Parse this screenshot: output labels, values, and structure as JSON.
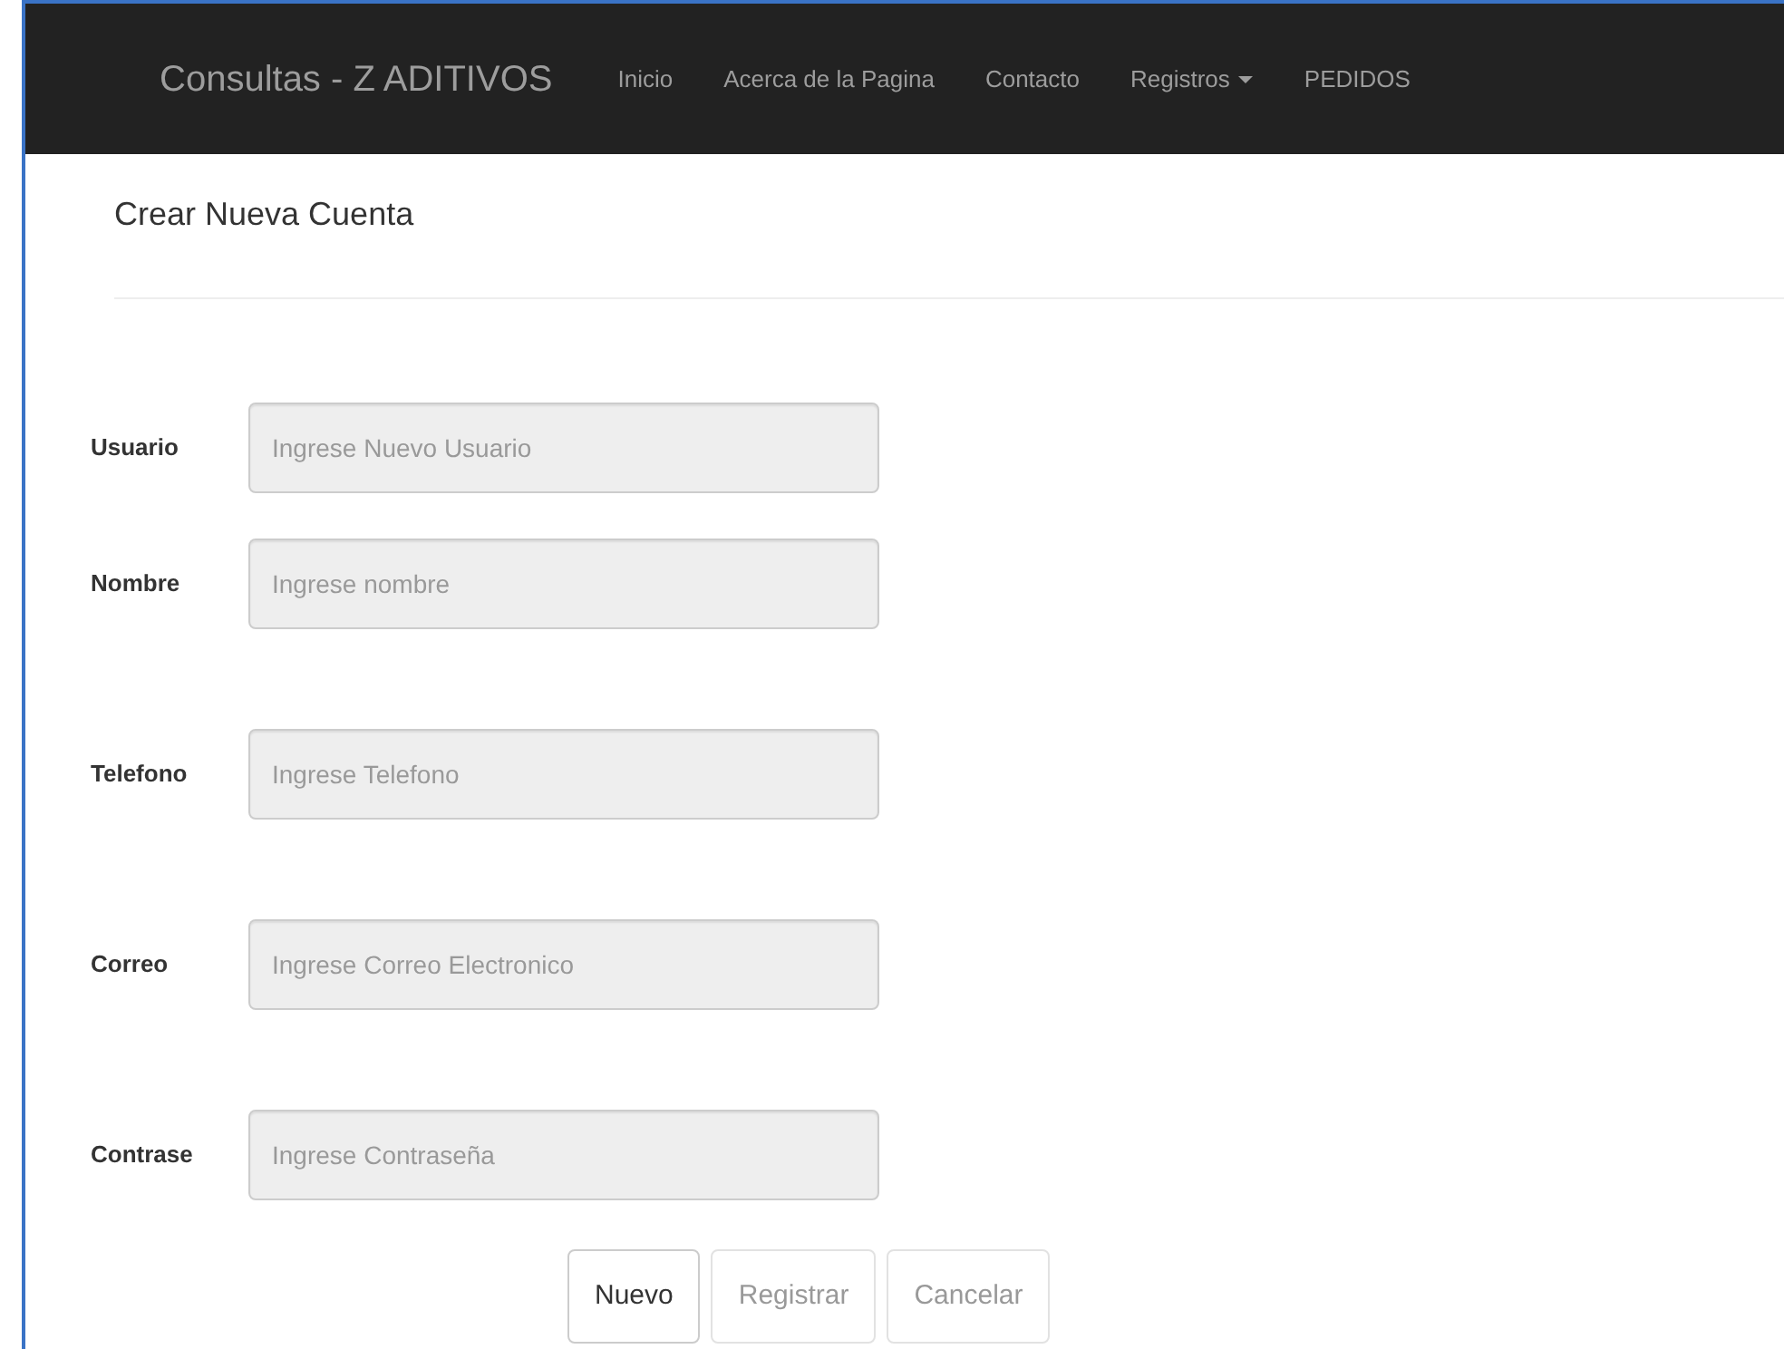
{
  "navbar": {
    "brand": "Consultas - Z ADITIVOS",
    "links": [
      {
        "label": "Inicio",
        "kind": "link"
      },
      {
        "label": "Acerca de la Pagina",
        "kind": "link"
      },
      {
        "label": "Contacto",
        "kind": "link"
      },
      {
        "label": "Registros",
        "kind": "dropdown"
      },
      {
        "label": "PEDIDOS",
        "kind": "link"
      }
    ]
  },
  "page_title": "Crear Nueva Cuenta",
  "form": {
    "fields": [
      {
        "label": "Usuario",
        "placeholder": "Ingrese Nuevo Usuario",
        "disabled": true
      },
      {
        "label": "Nombre",
        "placeholder": "Ingrese nombre",
        "disabled": true
      },
      {
        "label": "Telefono",
        "placeholder": "Ingrese Telefono",
        "disabled": true
      },
      {
        "label": "Correo",
        "placeholder": "Ingrese Correo Electronico",
        "disabled": true
      },
      {
        "label": "Contrase",
        "placeholder": "Ingrese Contraseña",
        "disabled": true
      }
    ],
    "buttons": [
      {
        "label": "Nuevo",
        "disabled": false
      },
      {
        "label": "Registrar",
        "disabled": true
      },
      {
        "label": "Cancelar",
        "disabled": true
      }
    ]
  }
}
